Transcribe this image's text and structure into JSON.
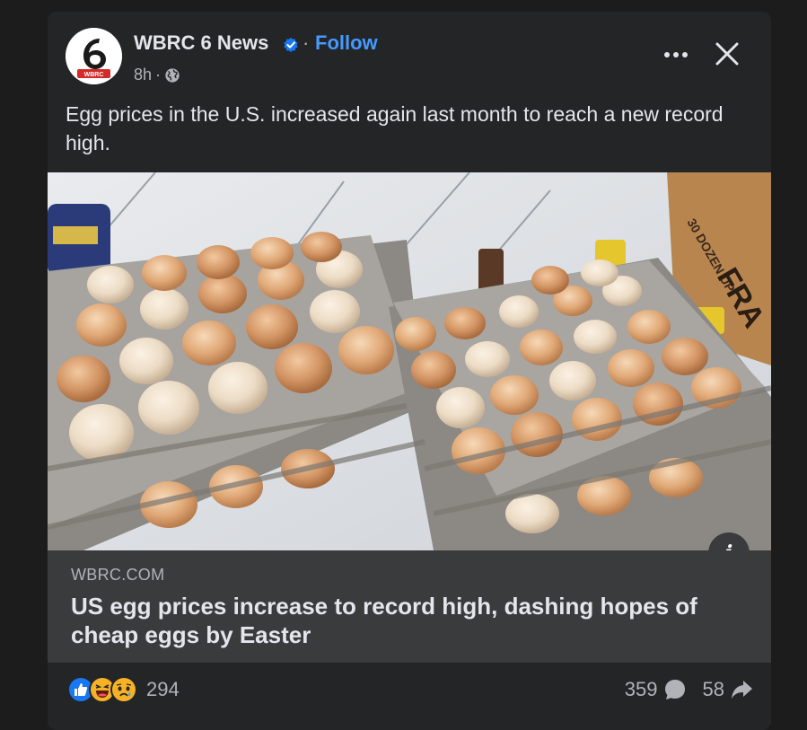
{
  "post": {
    "page_name": "WBRC 6 News",
    "follow_label": "Follow",
    "separator": "·",
    "time": "8h",
    "time_separator": "·",
    "avatar_logo_text": "WBRC",
    "text": "Egg prices in the U.S. increased again last month to reach a new record high."
  },
  "photo": {
    "box_text": "30 DOZEN UP",
    "box_brand": "FRA"
  },
  "link": {
    "domain": "WBRC.COM",
    "title": "US egg prices increase to record high, dashing hopes of cheap eggs by Easter"
  },
  "stats": {
    "reactions_count": "294",
    "comments_count": "359",
    "shares_count": "58"
  },
  "icons": {
    "verified": "verified-badge-icon",
    "globe": "globe-icon",
    "more": "more-options-icon",
    "close": "close-icon",
    "info": "info-icon",
    "like": "like-reaction-icon",
    "haha": "haha-reaction-icon",
    "sad": "sad-reaction-icon",
    "comment": "comment-icon",
    "share": "share-icon"
  },
  "colors": {
    "background": "#1c1c1d",
    "card": "#242526",
    "link_box": "#3a3b3c",
    "follow": "#4599ff",
    "verified": "#1877f2",
    "like": "#1877f2"
  }
}
